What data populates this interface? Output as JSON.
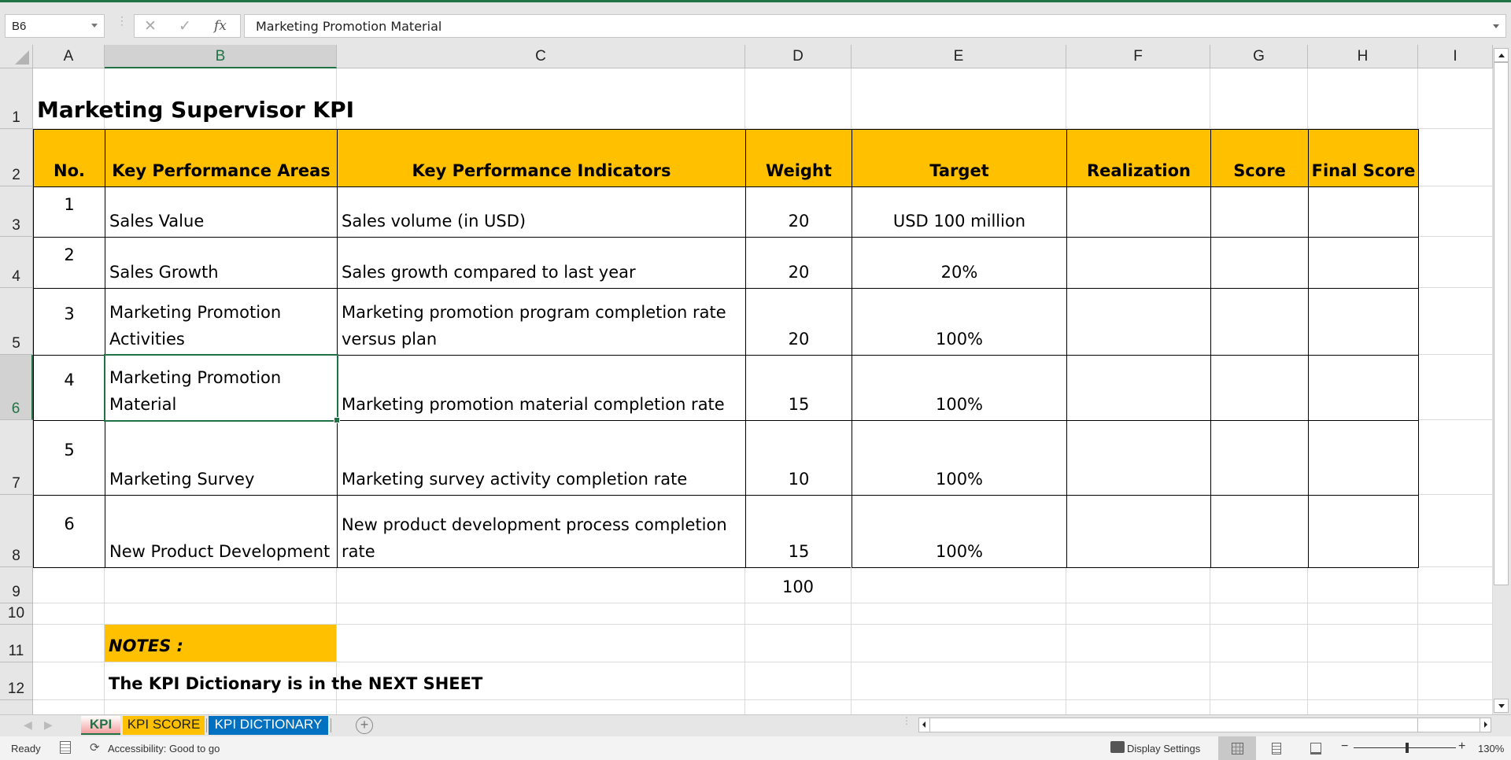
{
  "app": {
    "accent_color": "#217346"
  },
  "formula_bar": {
    "name_box": "B6",
    "cancel_icon": "✕",
    "enter_icon": "✓",
    "fx_label": "fx",
    "content": "Marketing Promotion Material"
  },
  "columns": [
    "A",
    "B",
    "C",
    "D",
    "E",
    "F",
    "G",
    "H",
    "I"
  ],
  "selected_column": "B",
  "rows": [
    "1",
    "2",
    "3",
    "4",
    "5",
    "6",
    "7",
    "8",
    "9",
    "10",
    "11",
    "12"
  ],
  "selected_row": "6",
  "sheet": {
    "title": "Marketing Supervisor KPI",
    "header_color": "#ffc000",
    "headers": [
      "No.",
      "Key Performance Areas",
      "Key Performance Indicators",
      "Weight",
      "Target",
      "Realization",
      "Score",
      "Final Score"
    ],
    "kpis": [
      {
        "no": "1",
        "area": "Sales Value",
        "indicator": "Sales volume (in USD)",
        "weight": "20",
        "target": "USD 100 million",
        "realization": "",
        "score": "",
        "final_score": ""
      },
      {
        "no": "2",
        "area": "Sales Growth",
        "indicator": "Sales growth compared to last year",
        "weight": "20",
        "target": "20%",
        "realization": "",
        "score": "",
        "final_score": ""
      },
      {
        "no": "3",
        "area": "Marketing Promotion Activities",
        "indicator": "Marketing promotion program completion rate versus plan",
        "weight": "20",
        "target": "100%",
        "realization": "",
        "score": "",
        "final_score": ""
      },
      {
        "no": "4",
        "area": "Marketing Promotion Material",
        "indicator": "Marketing promotion material completion rate",
        "weight": "15",
        "target": "100%",
        "realization": "",
        "score": "",
        "final_score": ""
      },
      {
        "no": "5",
        "area": "Marketing Survey",
        "indicator": "Marketing survey activity completion rate",
        "weight": "10",
        "target": "100%",
        "realization": "",
        "score": "",
        "final_score": ""
      },
      {
        "no": "6",
        "area": "New Product Development",
        "indicator": "New product development process completion rate",
        "weight": "15",
        "target": "100%",
        "realization": "",
        "score": "",
        "final_score": ""
      }
    ],
    "total_weight": "100",
    "notes_label": "NOTES :",
    "notes_text": "The KPI Dictionary is in the NEXT SHEET"
  },
  "sheet_tabs": [
    {
      "label": "KPI",
      "active": true,
      "color": "#f4a0a0"
    },
    {
      "label": "KPI SCORE",
      "active": false,
      "color": "#ffc000"
    },
    {
      "label": "KPI DICTIONARY",
      "active": false,
      "color": "#0070c0"
    }
  ],
  "add_sheet_icon": "+",
  "status_bar": {
    "ready": "Ready",
    "accessibility": "Accessibility: Good to go",
    "display_settings": "Display Settings",
    "zoom_minus": "−",
    "zoom_plus": "+",
    "zoom": "130%",
    "zoom_level_percent": 130
  }
}
